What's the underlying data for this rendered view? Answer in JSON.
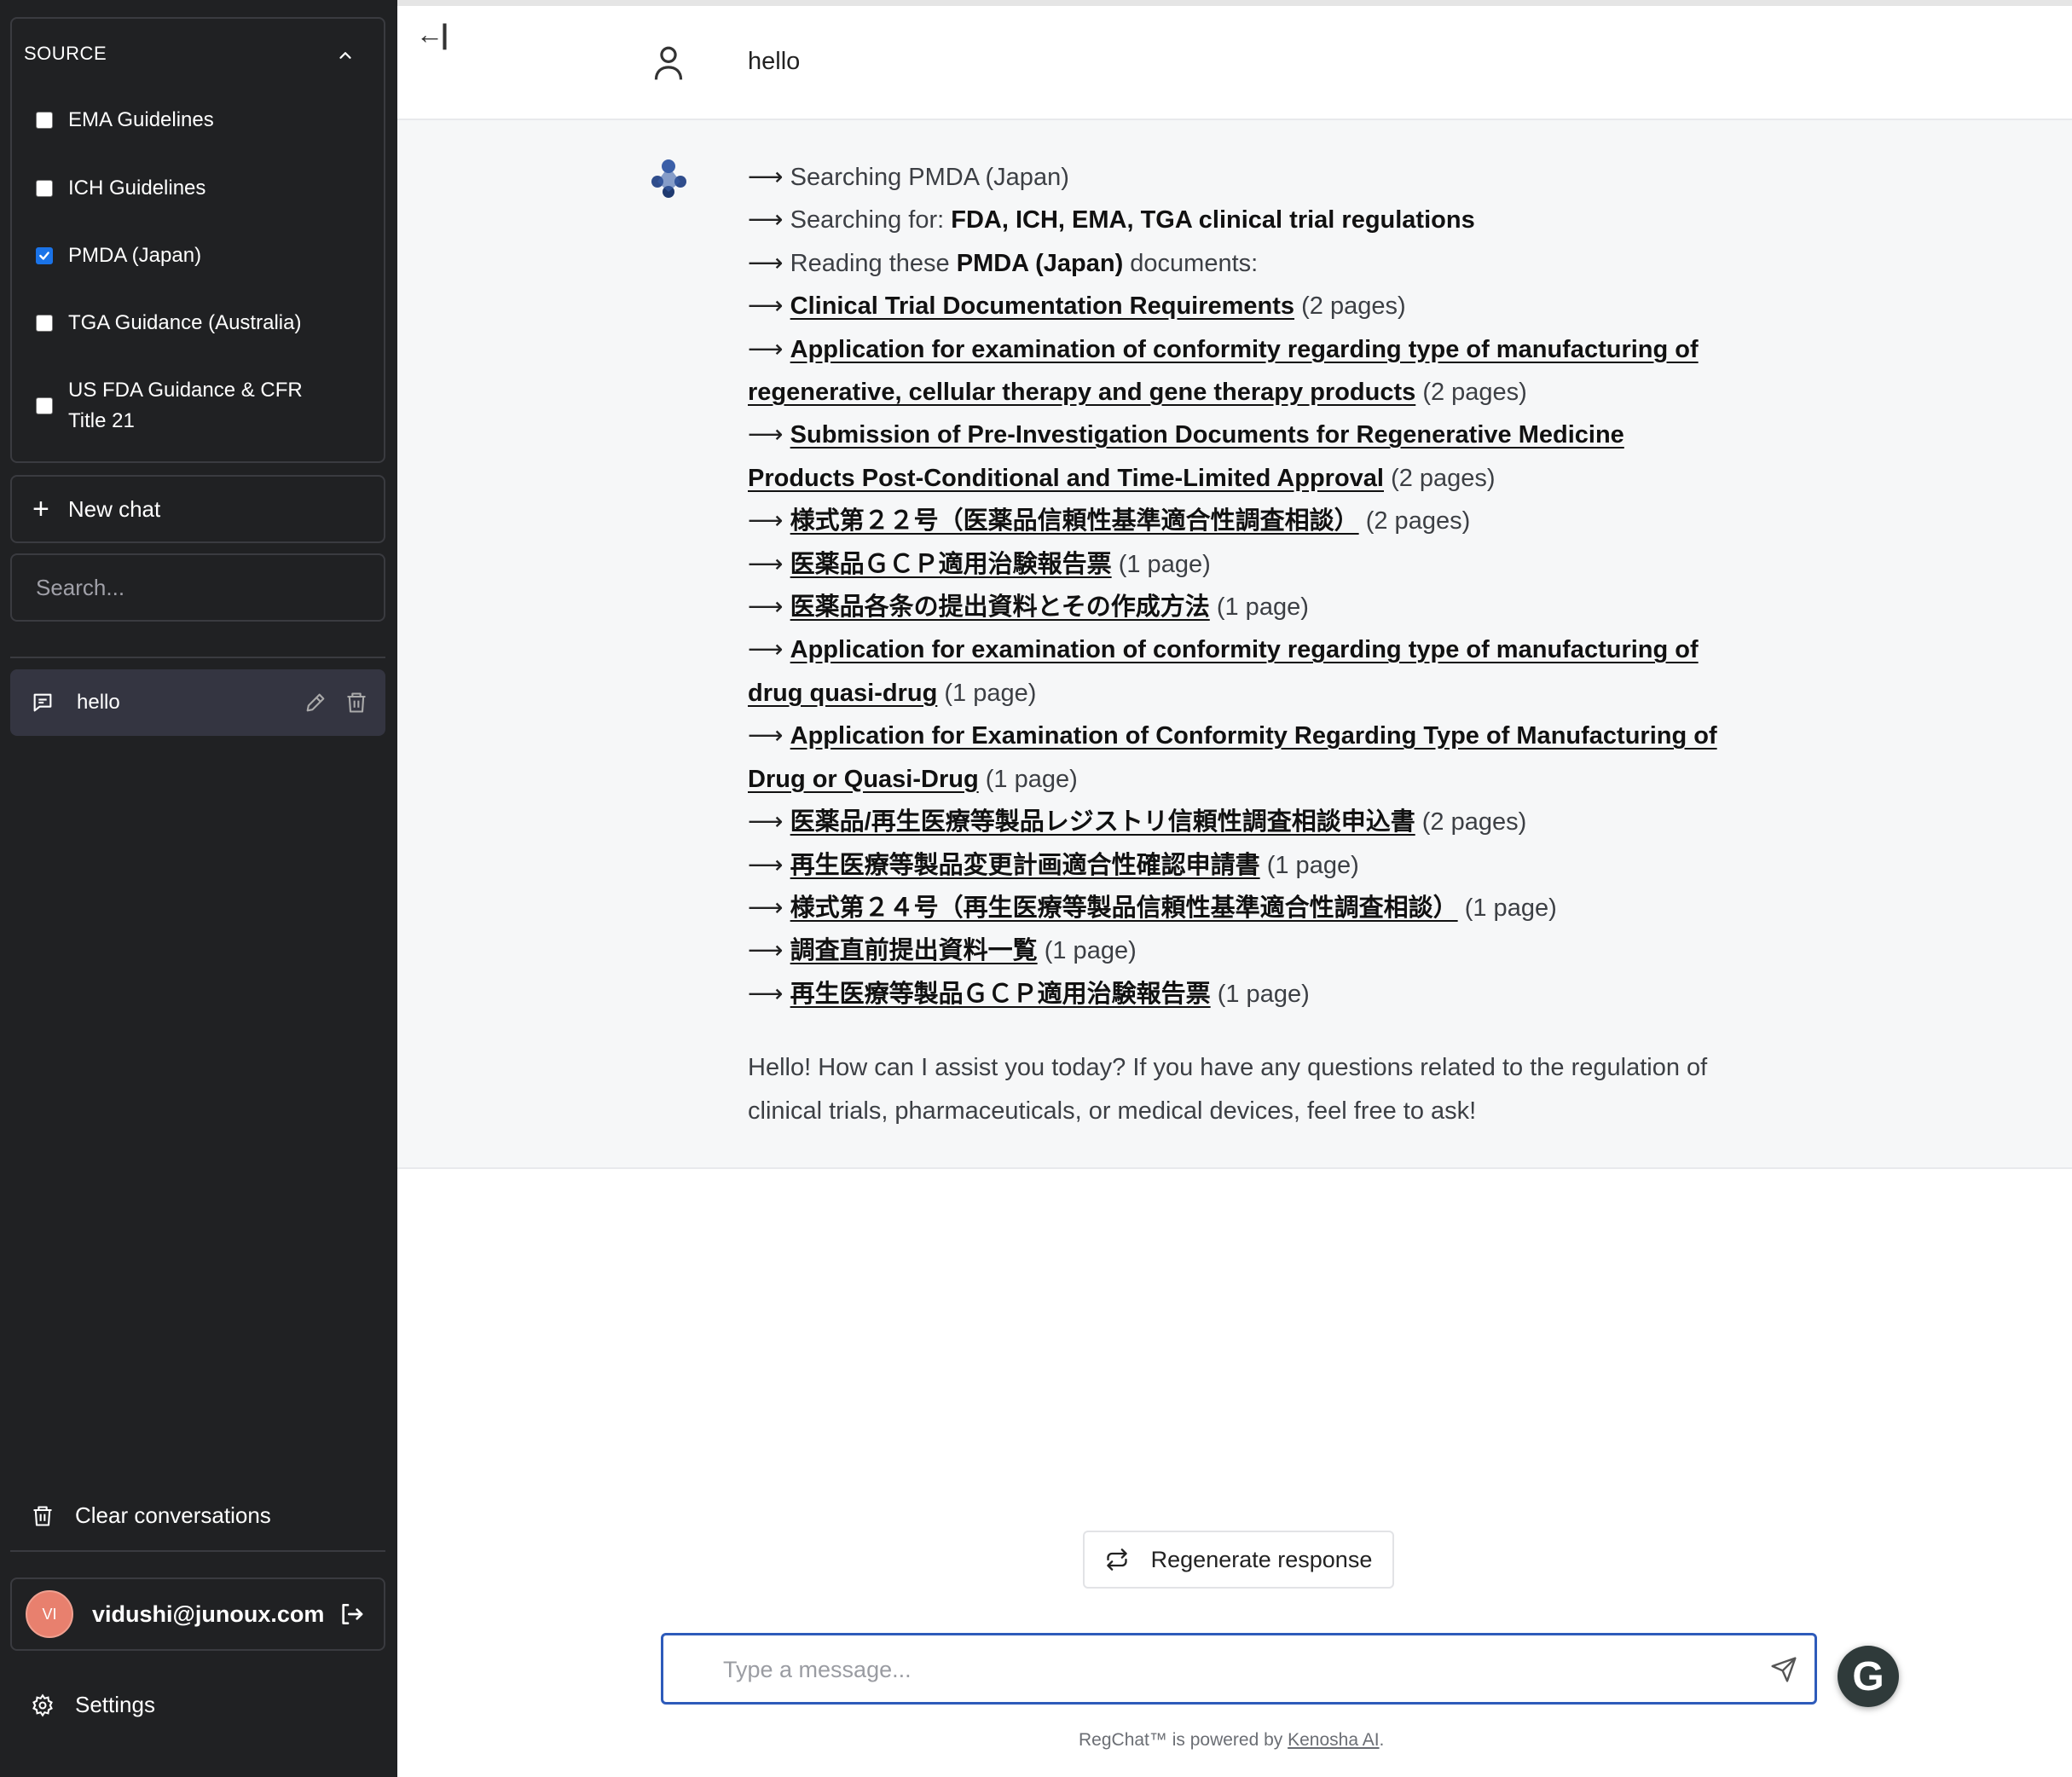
{
  "sidebar": {
    "source_header": "SOURCE",
    "sources": [
      {
        "label": "EMA Guidelines",
        "checked": false
      },
      {
        "label": "ICH Guidelines",
        "checked": false
      },
      {
        "label": "PMDA (Japan)",
        "checked": true
      },
      {
        "label": "TGA Guidance (Australia)",
        "checked": false
      },
      {
        "label": "US FDA Guidance & CFR Title 21",
        "checked": false
      }
    ],
    "new_chat_label": "New chat",
    "search_placeholder": "Search...",
    "conversations": [
      {
        "label": "hello"
      }
    ],
    "clear_label": "Clear conversations",
    "user": {
      "initials": "VI",
      "email": "vidushi@junoux.com"
    },
    "settings_label": "Settings"
  },
  "main": {
    "collapse_glyph": "←|",
    "user_message": "hello",
    "bot": {
      "arrow": "⟶",
      "searching_pmda": "Searching PMDA (Japan)",
      "searching_for_prefix": "Searching for: ",
      "searching_for_query": "FDA, ICH, EMA, TGA clinical trial regulations",
      "reading_prefix": "Reading these ",
      "reading_source": "PMDA (Japan)",
      "reading_suffix": " documents:",
      "documents": [
        {
          "title": "Clinical Trial Documentation Requirements",
          "pages": "(2 pages)"
        },
        {
          "title": "Application for examination of conformity regarding type of manufacturing of regenerative, cellular therapy and gene therapy products",
          "pages": "(2 pages)"
        },
        {
          "title": "Submission of Pre-Investigation Documents for Regenerative Medicine Products Post-Conditional and Time-Limited Approval",
          "pages": "(2 pages)"
        },
        {
          "title": "様式第２２号（医薬品信頼性基準適合性調査相談）",
          "pages": "(2 pages)"
        },
        {
          "title": "医薬品ＧＣＰ適用治験報告票",
          "pages": "(1 page)"
        },
        {
          "title": "医薬品各条の提出資料とその作成方法",
          "pages": "(1 page)"
        },
        {
          "title": "Application for examination of conformity regarding type of manufacturing of drug quasi-drug",
          "pages": "(1 page)"
        },
        {
          "title": "Application for Examination of Conformity Regarding Type of Manufacturing of Drug or Quasi-Drug",
          "pages": "(1 page)"
        },
        {
          "title": "医薬品/再生医療等製品レジストリ信頼性調査相談申込書",
          "pages": "(2 pages)"
        },
        {
          "title": "再生医療等製品変更計画適合性確認申請書",
          "pages": "(1 page)"
        },
        {
          "title": "様式第２４号（再生医療等製品信頼性基準適合性調査相談）",
          "pages": "(1 page)"
        },
        {
          "title": "調査直前提出資料一覧",
          "pages": "(1 page)"
        },
        {
          "title": "再生医療等製品ＧＣＰ適用治験報告票",
          "pages": "(1 page)"
        }
      ],
      "answer": "Hello! How can I assist you today? If you have any questions related to the regulation of clinical trials, pharmaceuticals, or medical devices, feel free to ask!"
    },
    "regenerate_label": "Regenerate response",
    "input_placeholder": "Type a message...",
    "footer_prefix": "RegChat™ is powered by ",
    "footer_link": "Kenosha AI",
    "footer_suffix": "."
  }
}
